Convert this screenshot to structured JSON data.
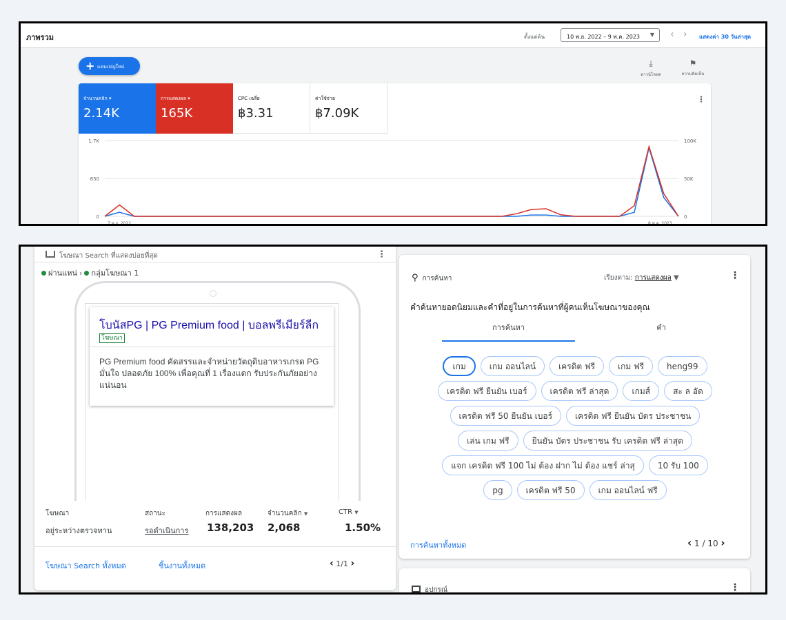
{
  "overview": {
    "title": "ภาพรวม",
    "since_label": "ตั้งแต่ต้น",
    "date_range": "10 พ.ย. 2022 – 9 พ.ค. 2023",
    "show_last": "แสดงค่า 30 วันล่าสุด",
    "new_campaign": "แคมเปญใหม่",
    "download": "ดาวน์โหลด",
    "feedback": "ความคิดเห็น"
  },
  "metrics": [
    {
      "label": "จำนวนคลิก",
      "value": "2.14K",
      "color": "#1a73e8"
    },
    {
      "label": "การแสดงผล",
      "value": "165K",
      "color": "#d93025"
    },
    {
      "label": "CPC เฉลี่ย",
      "value": "฿3.31"
    },
    {
      "label": "ค่าใช้จ่าย",
      "value": "฿7.09K"
    }
  ],
  "chart_data": {
    "type": "line",
    "x_start_label": "7 พ.ย. 2022",
    "x_end_label": "8 พ.ค. 2023",
    "y_left_ticks": [
      "1.7K",
      "850",
      "0"
    ],
    "y_right_ticks": [
      "100K",
      "50K",
      "0"
    ],
    "ylim_left": [
      0,
      1700
    ],
    "ylim_right": [
      0,
      100000
    ],
    "series": [
      {
        "name": "จำนวนคลิก",
        "color": "#1a73e8",
        "axis": "left",
        "values": [
          0,
          90,
          0,
          0,
          0,
          0,
          0,
          0,
          0,
          0,
          0,
          0,
          0,
          0,
          0,
          0,
          0,
          0,
          0,
          0,
          0,
          0,
          0,
          0,
          0,
          0,
          0,
          0,
          0,
          30,
          30,
          0,
          0,
          0,
          0,
          0,
          90,
          1540,
          420,
          0
        ]
      },
      {
        "name": "การแสดงผล",
        "color": "#d93025",
        "axis": "right",
        "values": [
          0,
          15000,
          0,
          0,
          0,
          0,
          0,
          0,
          0,
          0,
          0,
          0,
          0,
          0,
          0,
          0,
          0,
          0,
          0,
          0,
          0,
          0,
          0,
          0,
          0,
          0,
          0,
          0,
          3500,
          9000,
          10000,
          2000,
          0,
          0,
          0,
          0,
          14000,
          92000,
          30000,
          0
        ]
      }
    ]
  },
  "ad_card": {
    "header": "โฆษณา Search ที่แสดงบ่อยที่สุด",
    "crumb_campaign": "ผ่านแหน่",
    "crumb_sep": "›",
    "crumb_adgroup": "กลุ่มโฆษณา 1",
    "ad_title": "โบนัสPG | PG Premium food | บอลพรีเมียร์ลีก",
    "ad_badge": "โฆษณา",
    "ad_description": "PG Premium food คัดสรรและจำหน่ายวัตถุดิบอาหารเกรด PG มั่นใจ ปลอดภัย 100% เพื่อคุณที่ 1 เรื่องแดก รับประกันภัยอย่างแน่นอน",
    "col_ad": "โฆษณา",
    "col_status": "สถานะ",
    "col_impressions": "การแสดงผล",
    "col_clicks": "จำนวนคลิก",
    "col_ctr": "CTR",
    "row_ad": "อยู่ระหว่างตรวจทาน",
    "row_status": "รอดำเนินการ",
    "row_impressions": "138,203",
    "row_clicks": "2,068",
    "row_ctr": "1.50%",
    "link_all_ads": "โฆษณา Search ทั้งหมด",
    "link_all_assets": "ชิ้นงานทั้งหมด",
    "pager": "1/1"
  },
  "search_card": {
    "title": "การค้นหา",
    "sort_label": "เรียงตาม:",
    "sort_value": "การแสดงผล",
    "description": "คำค้นหายอดนิยมและคำที่อยู่ในการค้นหาที่ผู้คนเห็นโฆษณาของคุณ",
    "tab_searches": "การค้นหา",
    "tab_words": "คำ",
    "chip_rows": [
      [
        "เกม",
        "เกม ออนไลน์",
        "เครดิต ฟรี",
        "เกม ฟรี",
        "heng99"
      ],
      [
        "เครดิต ฟรี ยืนยัน เบอร์",
        "เครดิต ฟรี ล่าสุด",
        "เกมส์",
        "สะ ล อัด"
      ],
      [
        "เครดิต ฟรี 50 ยืนยัน เบอร์",
        "เครดิต ฟรี ยืนยัน บัตร ประชาชน"
      ],
      [
        "เล่น เกม ฟรี",
        "ยืนยัน บัตร ประชาชน รับ เครดิต ฟรี ล่าสุด"
      ],
      [
        "แจก เครดิต ฟรี 100 ไม่ ต้อง ฝาก ไม่ ต้อง แชร์ ล่าสุ",
        "10 รับ 100"
      ],
      [
        "pg",
        "เครดิต ฟรี 50",
        "เกม ออนไลน์ ฟรี"
      ]
    ],
    "link_all": "การค้นหาทั้งหมด",
    "pager": "1 / 10"
  },
  "device_card": {
    "title": "อุปกรณ์"
  }
}
